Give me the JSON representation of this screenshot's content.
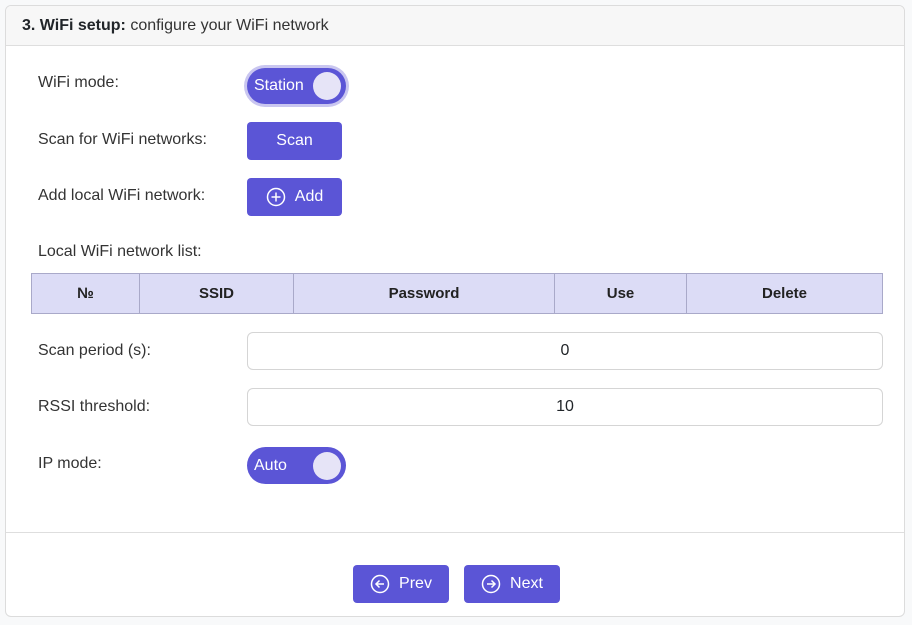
{
  "header": {
    "step": "3. WiFi setup:",
    "description": "configure your WiFi network"
  },
  "wifi_mode": {
    "label": "WiFi mode:",
    "value": "Station"
  },
  "scan": {
    "label": "Scan for WiFi networks:",
    "button": "Scan"
  },
  "add_network": {
    "label": "Add local WiFi network:",
    "button": "Add"
  },
  "network_list": {
    "label": "Local WiFi network list:",
    "columns": [
      "№",
      "SSID",
      "Password",
      "Use",
      "Delete"
    ]
  },
  "scan_period": {
    "label": "Scan period (s):",
    "value": "0"
  },
  "rssi_threshold": {
    "label": "RSSI threshold:",
    "value": "10"
  },
  "ip_mode": {
    "label": "IP mode:",
    "value": "Auto"
  },
  "nav": {
    "prev": "Prev",
    "next": "Next"
  },
  "colors": {
    "primary": "#5b55d6",
    "table_header": "#dcdcf6"
  }
}
